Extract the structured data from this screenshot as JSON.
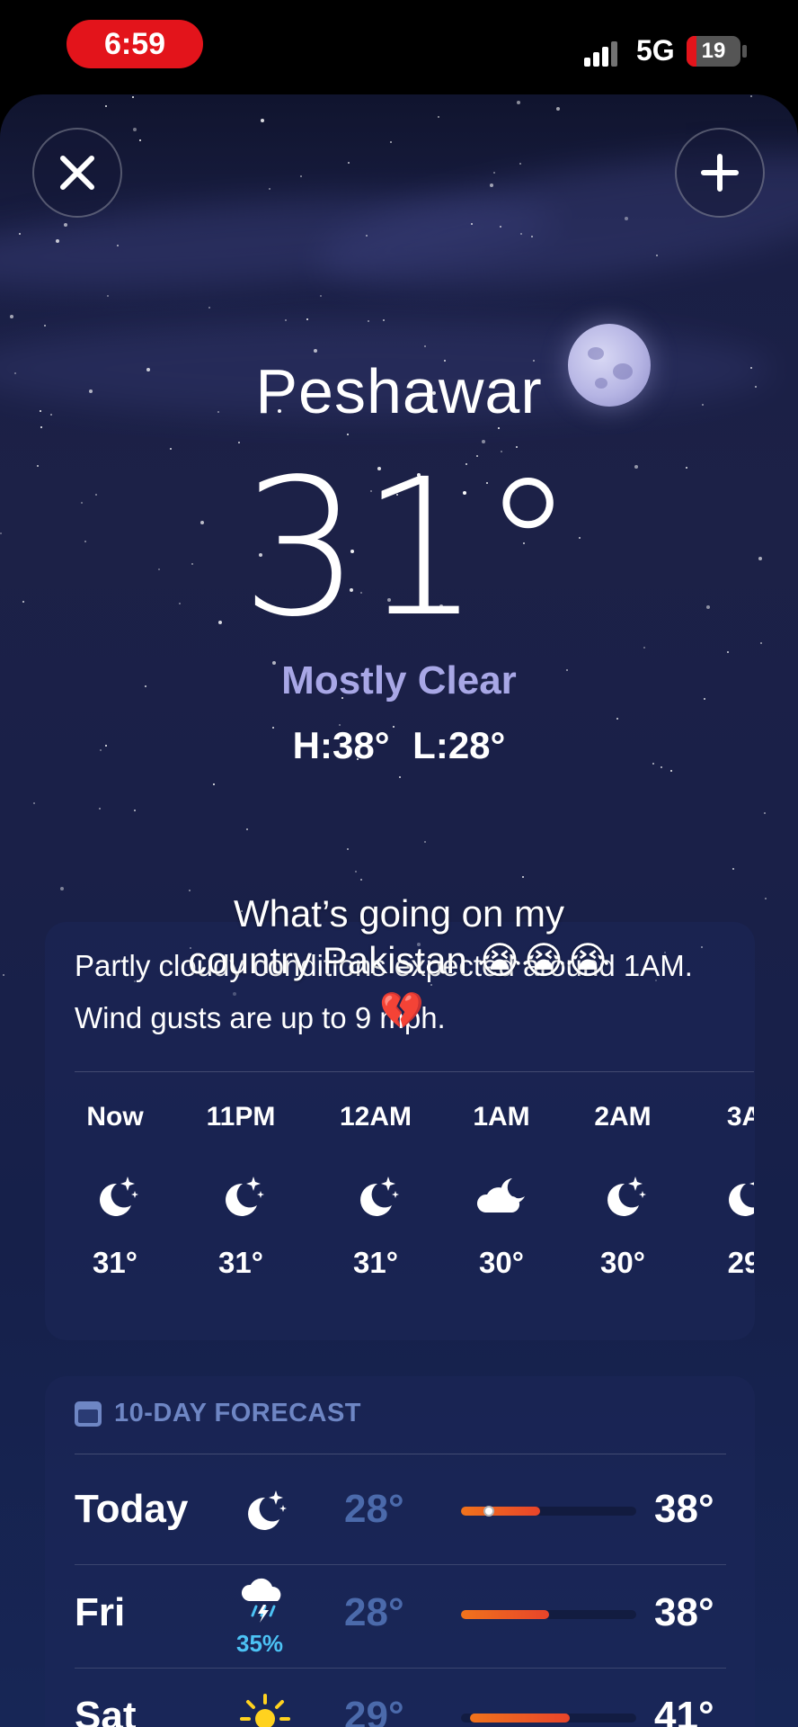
{
  "status_bar": {
    "time": "6:59",
    "network": "5G",
    "battery": "19",
    "battery_level": 0.19
  },
  "buttons": {
    "close_icon": "close-icon",
    "add_icon": "plus-icon"
  },
  "weather": {
    "city": "Peshawar",
    "temperature": "31°",
    "condition": "Mostly Clear",
    "high_low": "H:38° L:28°"
  },
  "overlay_caption": {
    "line1": "What’s going on my",
    "line2": "country Pakistan 😭😭😭",
    "emoji": "💔"
  },
  "summary": "Partly cloudy conditions expected around 1AM. Wind gusts are up to 9 mph.",
  "hourly": [
    {
      "time": "Now",
      "icon": "moon-stars-icon",
      "temp": "31°"
    },
    {
      "time": "11PM",
      "icon": "moon-stars-icon",
      "temp": "31°"
    },
    {
      "time": "12AM",
      "icon": "moon-stars-icon",
      "temp": "31°"
    },
    {
      "time": "1AM",
      "icon": "cloud-moon-icon",
      "temp": "30°"
    },
    {
      "time": "2AM",
      "icon": "moon-stars-icon",
      "temp": "30°"
    },
    {
      "time": "3A",
      "icon": "moon-stars-icon",
      "temp": "29"
    }
  ],
  "forecast": {
    "title": "10-DAY FORECAST",
    "days": [
      {
        "day": "Today",
        "icon": "moon-stars-icon",
        "precip": "",
        "low": "28°",
        "high": "38°",
        "range_start": 0.0,
        "range_end": 0.45,
        "now_position": 0.16
      },
      {
        "day": "Fri",
        "icon": "thunderstorm-icon",
        "precip": "35%",
        "low": "28°",
        "high": "38°",
        "range_start": 0.0,
        "range_end": 0.5
      },
      {
        "day": "Sat",
        "icon": "sun-icon",
        "precip": "",
        "low": "29°",
        "high": "41°",
        "range_start": 0.05,
        "range_end": 0.62
      }
    ]
  },
  "colors": {
    "condition": "#a8a7e6",
    "low_temp": "#4b6aab",
    "accent_red": "#e3141b",
    "precip": "#4cc3f5"
  }
}
